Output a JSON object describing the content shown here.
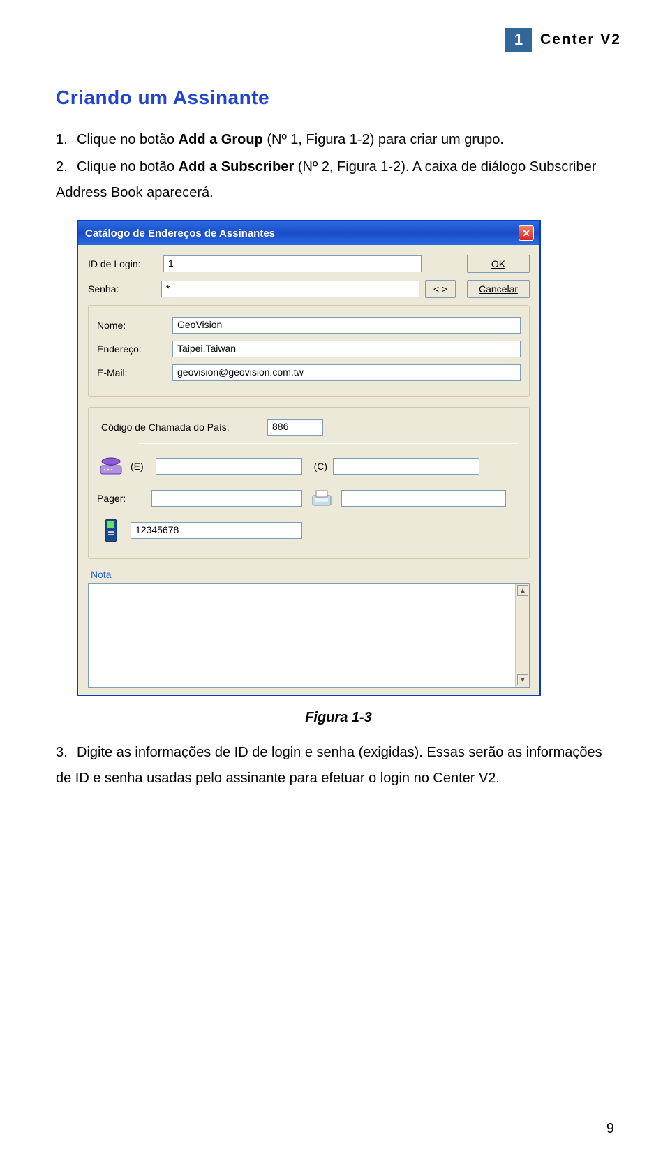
{
  "header": {
    "chapter_num": "1",
    "chapter_title": "Center V2"
  },
  "section_title": "Criando um Assinante",
  "steps": {
    "s1": {
      "num": "1.",
      "pre": "Clique no botão ",
      "bold": "Add a Group",
      "post": " (Nº 1, Figura 1-2) para criar um grupo."
    },
    "s2": {
      "num": "2.",
      "pre": "Clique no botão ",
      "bold": "Add a Subscriber",
      "post": " (Nº 2, Figura 1-2). A caixa de diálogo Subscriber Address Book aparecerá."
    },
    "s3": {
      "num": "3.",
      "text": "Digite as informações de ID de login e senha (exigidas). Essas serão as informações de ID e senha usadas pelo assinante para efetuar o login no Center V2."
    }
  },
  "dialog": {
    "title": "Catálogo de Endereços de Assinantes",
    "labels": {
      "login_id": "ID de Login:",
      "password": "Senha:",
      "name": "Nome:",
      "address": "Endereço:",
      "email": "E-Mail:",
      "country_code": "Código de Chamada do País:",
      "phone_e": "(E)",
      "phone_c": "(C)",
      "pager": "Pager:",
      "note": "Nota"
    },
    "values": {
      "login_id": "1",
      "password": "*",
      "name": "GeoVision",
      "address": "Taipei,Taiwan",
      "email": "geovision@geovision.com.tw",
      "country_code": "886",
      "phone_e": "",
      "phone_c": "",
      "pager": "",
      "fax": "",
      "mobile": "12345678",
      "note": ""
    },
    "buttons": {
      "ok": "OK",
      "cancel": "Cancelar",
      "swap": "< >"
    }
  },
  "figure_caption": "Figura 1-3",
  "page_number": "9"
}
